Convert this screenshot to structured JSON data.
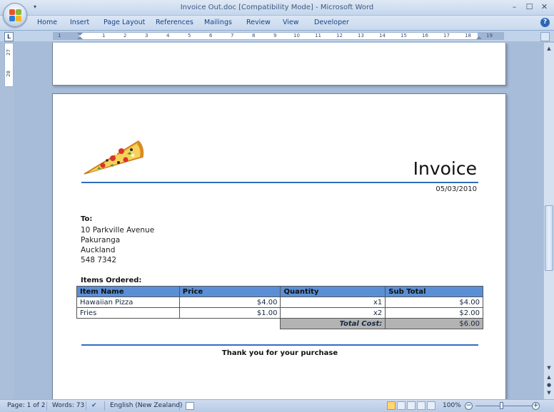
{
  "window": {
    "title": "Invoice Out.doc [Compatibility Mode] - Microsoft Word",
    "controls": {
      "minimize": "–",
      "maximize": "☐",
      "close": "✕"
    }
  },
  "ribbon": {
    "tabs": [
      "Home",
      "Insert",
      "Page Layout",
      "References",
      "Mailings",
      "Review",
      "View",
      "Developer"
    ],
    "help": "?"
  },
  "ruler": {
    "horizontal_labels": [
      "1",
      "1",
      "2",
      "3",
      "4",
      "5",
      "6",
      "7",
      "8",
      "9",
      "10",
      "11",
      "12",
      "13",
      "14",
      "15",
      "16",
      "17",
      "18",
      "19"
    ],
    "vertical_labels": [
      "27",
      "28"
    ],
    "toggle_label": "L"
  },
  "document": {
    "heading": "Invoice",
    "date": "05/03/2010",
    "to_label": "To:",
    "address": [
      "10 Parkville Avenue",
      "Pakuranga",
      "Auckland",
      "548 7342"
    ],
    "items_label": "Items Ordered:",
    "table": {
      "headers": [
        "Item Name",
        "Price",
        "Quantity",
        "Sub Total"
      ],
      "rows": [
        [
          "Hawaiian Pizza",
          "$4.00",
          "x1",
          "$4.00"
        ],
        [
          "Fries",
          "$1.00",
          "x2",
          "$2.00"
        ]
      ],
      "total_label": "Total Cost:",
      "total_value": "$6.00"
    },
    "thanks": "Thank you for your purchase"
  },
  "status": {
    "page": "Page: 1 of 2",
    "words": "Words: 73",
    "language": "English (New Zealand)",
    "zoom": "100%",
    "zoom_minus": "−",
    "zoom_plus": "+"
  },
  "colors": {
    "accent_rule": "#2f6fbf",
    "table_header": "#5a8fd6",
    "total_row": "#b3b3b3"
  }
}
